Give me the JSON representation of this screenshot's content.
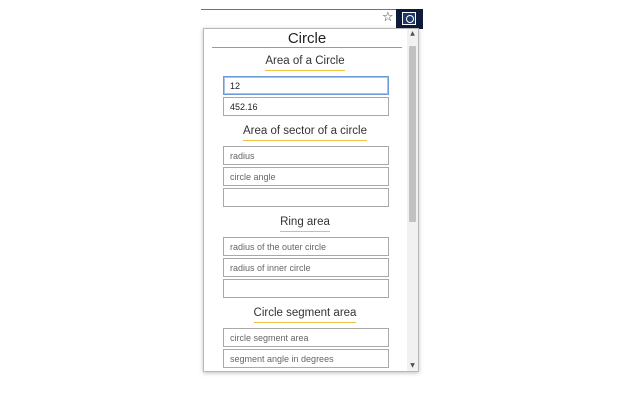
{
  "browser": {
    "star_glyph": "☆",
    "extension_icon": "calculator-extension-icon"
  },
  "popup": {
    "title": "Circle",
    "sections": [
      {
        "title": "Area of a Circle",
        "fields": [
          {
            "value": "12",
            "placeholder": ""
          },
          {
            "value": "452.16",
            "placeholder": ""
          }
        ]
      },
      {
        "title": "Area of sector of a circle",
        "fields": [
          {
            "value": "",
            "placeholder": "radius"
          },
          {
            "value": "",
            "placeholder": "circle angle"
          },
          {
            "value": "",
            "placeholder": ""
          }
        ]
      },
      {
        "title": "Ring area",
        "fields": [
          {
            "value": "",
            "placeholder": "radius of the outer circle"
          },
          {
            "value": "",
            "placeholder": "radius of inner circle"
          },
          {
            "value": "",
            "placeholder": ""
          }
        ]
      },
      {
        "title": "Circle segment area",
        "fields": [
          {
            "value": "",
            "placeholder": "circle segment area"
          },
          {
            "value": "",
            "placeholder": "segment angle in degrees"
          }
        ]
      }
    ]
  },
  "scrollbar": {
    "up_arrow": "▲",
    "down_arrow": "▼"
  },
  "colors": {
    "accent_underline": "#f0c040",
    "focus_border": "#6c9ad8",
    "extension_background": "#0e1a3a"
  }
}
